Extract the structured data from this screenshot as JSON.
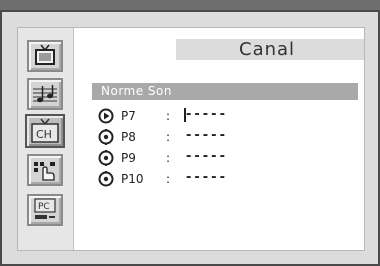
{
  "menu": {
    "title": "Canal",
    "section": "Norme Son",
    "sidebar": [
      {
        "icon": "tv-picture-icon",
        "active": false
      },
      {
        "icon": "music-note-icon",
        "active": false
      },
      {
        "icon": "ch-channel-icon",
        "label": "CH",
        "active": true
      },
      {
        "icon": "setup-hand-icon",
        "active": false
      },
      {
        "icon": "pc-icon",
        "label": "PC",
        "active": false
      }
    ],
    "rows": [
      {
        "label": "P7",
        "colon": ":",
        "value": "-----",
        "icon": "play-circle-icon",
        "selected": true
      },
      {
        "label": "P8",
        "colon": ":",
        "value": "-----",
        "icon": "circle-icon",
        "selected": false
      },
      {
        "label": "P9",
        "colon": ":",
        "value": "-----",
        "icon": "circle-icon",
        "selected": false
      },
      {
        "label": "P10",
        "colon": ":",
        "value": "-----",
        "icon": "circle-icon",
        "selected": false
      }
    ]
  }
}
